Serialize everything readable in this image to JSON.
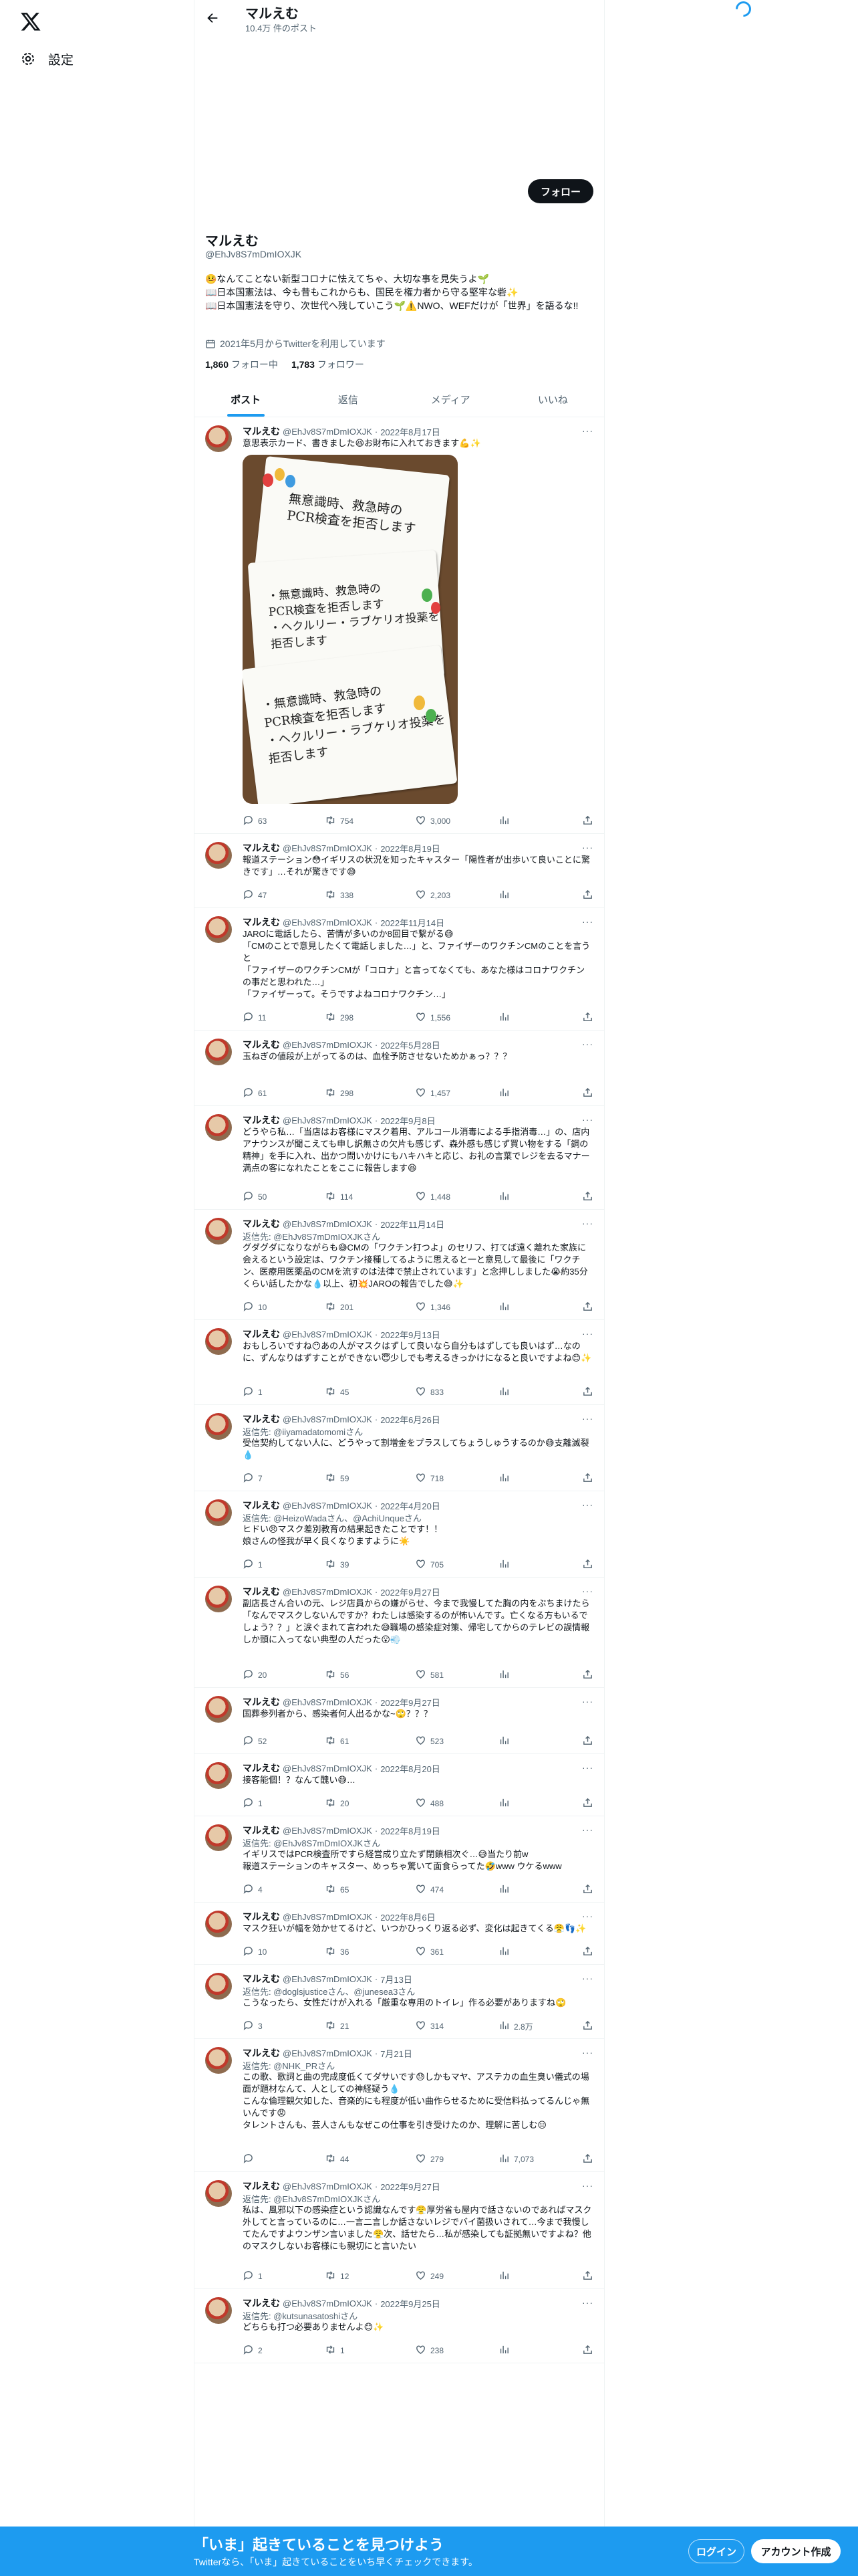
{
  "header": {
    "title": "マルえむ",
    "post_count": "10.4万 件のポスト",
    "follow_label": "フォロー"
  },
  "side": {
    "settings_label": "設定"
  },
  "profile": {
    "name": "マルえむ",
    "handle": "@EhJv8S7mDmIOXJK",
    "bio": [
      "🤒なんてことない新型コロナに怯えてちゃ、大切な事を見失うよ🌱",
      "📖日本国憲法は、今も昔もこれからも、国民を権力者から守る堅牢な砦✨",
      "📖日本国憲法を守り、次世代へ残していこう🌱⚠️NWO、WEFだけが「世界」を語るな!!"
    ],
    "joined": "2021年5月からTwitterを利用しています",
    "following_count": "1,860",
    "following_label": "フォロー中",
    "followers_count": "1,783",
    "followers_label": "フォロワー"
  },
  "tabs": [
    {
      "label": "ポスト"
    },
    {
      "label": "返信"
    },
    {
      "label": "メディア"
    },
    {
      "label": "いいね"
    }
  ],
  "tweets": [
    {
      "name": "マルえむ",
      "handle": "@EhJv8S7mDmIOXJK",
      "date": "2022年8月17日",
      "reply": "",
      "text": "意思表示カード、書きました😆お財布に入れておきます💪✨",
      "media": true,
      "replies": "63",
      "retweets": "754",
      "likes": "3,000",
      "views": ""
    },
    {
      "name": "マルえむ",
      "handle": "@EhJv8S7mDmIOXJK",
      "date": "2022年8月19日",
      "reply": "",
      "text": "報道ステーション😳イギリスの状況を知ったキャスター「陽性者が出歩いて良いことに驚きです」…それが驚きです😅",
      "replies": "47",
      "retweets": "338",
      "likes": "2,203",
      "views": ""
    },
    {
      "name": "マルえむ",
      "handle": "@EhJv8S7mDmIOXJK",
      "date": "2022年11月14日",
      "reply": "",
      "text": "JAROに電話したら、苦情が多いのか8回目で繋がる😅\n「CMのことで意見したくて電話しました…」と、ファイザーのワクチンCMのことを言うと\n「ファイザーのワクチンCMが「コロナ」と言ってなくても、あなた様はコロナワクチンの事だと思われた…」\n「ファイザーって。そうですよねコロナワクチン…」",
      "replies": "11",
      "retweets": "298",
      "likes": "1,556",
      "views": ""
    },
    {
      "name": "マルえむ",
      "handle": "@EhJv8S7mDmIOXJK",
      "date": "2022年5月28日",
      "reply": "",
      "text": "玉ねぎの値段が上がってるのは、血栓予防させないためかぁっ？？？",
      "replies": "61",
      "retweets": "298",
      "likes": "1,457",
      "views": ""
    },
    {
      "name": "マルえむ",
      "handle": "@EhJv8S7mDmIOXJK",
      "date": "2022年9月8日",
      "reply": "",
      "text": "どうやら私…「当店はお客様にマスク着用、アルコール消毒による手指消毒…」の、店内アナウンスが聞こえても申し訳無さの欠片も感じず、森外感も感じず買い物をする「鋼の精神」を手に入れ、出かつ問いかけにもハキハキと応じ、お礼の言葉でレジを去るマナー満点の客になれたことをここに報告します😆",
      "replies": "50",
      "retweets": "114",
      "likes": "1,448",
      "views": ""
    },
    {
      "name": "マルえむ",
      "handle": "@EhJv8S7mDmIOXJK",
      "date": "2022年11月14日",
      "reply": "返信先: @EhJv8S7mDmIOXJKさん",
      "text": "グダグダになりながらも😅CMの「ワクチン打つよ」のセリフ、打てば遠く離れた家族に会えるという設定は、ワクチン接種してるように思えると一と意見して最後に「ワクチン、医療用医薬品のCMを流すのは法律で禁止されています」と念押ししました😭約35分くらい話したかな💧以上、初💥JAROの報告でした😅✨",
      "replies": "10",
      "retweets": "201",
      "likes": "1,346",
      "views": ""
    },
    {
      "name": "マルえむ",
      "handle": "@EhJv8S7mDmIOXJK",
      "date": "2022年9月13日",
      "reply": "",
      "text": "おもしろいですね😶あの人がマスクはずして良いなら自分もはずしても良いはず…なのに、ずんなりはずすことができない😇少しでも考えるきっかけになると良いですよね😊✨",
      "replies": "1",
      "retweets": "45",
      "likes": "833",
      "views": ""
    },
    {
      "name": "マルえむ",
      "handle": "@EhJv8S7mDmIOXJK",
      "date": "2022年6月26日",
      "reply": "返信先: @iiyamadatomomiさん",
      "text": "受信契約してない人に、どうやって割増金をプラスしてちょうしゅうするのか😅支離滅裂💧",
      "replies": "7",
      "retweets": "59",
      "likes": "718",
      "views": ""
    },
    {
      "name": "マルえむ",
      "handle": "@EhJv8S7mDmIOXJK",
      "date": "2022年4月20日",
      "reply": "返信先: @HeizoWadaさん、@AchiUnqueさん",
      "text": "ヒドい😠マスク差別教育の結果起きたことです！！\n娘さんの怪我が早く良くなりますように☀️",
      "replies": "1",
      "retweets": "39",
      "likes": "705",
      "views": ""
    },
    {
      "name": "マルえむ",
      "handle": "@EhJv8S7mDmIOXJK",
      "date": "2022年9月27日",
      "reply": "",
      "text": "副店長さん合いの元、レジ店員からの嫌がらせ、今まで我慢してた胸の内をぶちまけたら「なんでマスクしないんですか？わたしは感染するのが怖いんです。亡くなる方もいるでしょう？？」と涙ぐまれて言われた😅職場の感染症対策、帰宅してからのテレビの誤情報しか頭に入ってない典型の人だった😮💨",
      "replies": "20",
      "retweets": "56",
      "likes": "581",
      "views": ""
    },
    {
      "name": "マルえむ",
      "handle": "@EhJv8S7mDmIOXJK",
      "date": "2022年9月27日",
      "reply": "",
      "text": "国葬参列者から、感染者何人出るかな~🙄？？？",
      "replies": "52",
      "retweets": "61",
      "likes": "523",
      "views": ""
    },
    {
      "name": "マルえむ",
      "handle": "@EhJv8S7mDmIOXJK",
      "date": "2022年8月20日",
      "reply": "",
      "text": "接客能個！？なんて醜い😅…",
      "replies": "1",
      "retweets": "20",
      "likes": "488",
      "views": ""
    },
    {
      "name": "マルえむ",
      "handle": "@EhJv8S7mDmIOXJK",
      "date": "2022年8月19日",
      "reply": "返信先: @EhJv8S7mDmIOXJKさん",
      "text": "イギリスではPCR検査所ですら経営成り立たず閉鎖相次ぐ…😅当たり前w\n報道ステーションのキャスター、めっちゃ驚いて面食らってた🤣www ウケるwww",
      "replies": "4",
      "retweets": "65",
      "likes": "474",
      "views": ""
    },
    {
      "name": "マルえむ",
      "handle": "@EhJv8S7mDmIOXJK",
      "date": "2022年8月6日",
      "reply": "",
      "text": "マスク狂いが幅を効かせてるけど、いつかひっくり返る必ず、変化は起きてくる😤👣✨",
      "replies": "10",
      "retweets": "36",
      "likes": "361",
      "views": ""
    },
    {
      "name": "マルえむ",
      "handle": "@EhJv8S7mDmIOXJK",
      "date": "7月13日",
      "reply": "返信先: @doglsjusticeさん、@junesea3さん",
      "text": "こうなったら、女性だけが入れる「厳重な専用のトイレ」作る必要がありますね🙄",
      "replies": "3",
      "retweets": "21",
      "likes": "314",
      "views": "2.8万"
    },
    {
      "name": "マルえむ",
      "handle": "@EhJv8S7mDmIOXJK",
      "date": "7月21日",
      "reply": "返信先: @NHK_PRさん",
      "text": "この歌、歌詞と曲の完成度低くてダサいです😓しかもマヤ、アステカの血生臭い儀式の場面が題材なんて、人としての神経疑う💧\nこんな倫理観欠如した、音楽的にも程度が低い曲作らせるために受信料払ってるんじゃ無いんです😡\nタレントさんも、芸人さんもなぜこの仕事を引き受けたのか、理解に苦しむ😑",
      "replies": "",
      "retweets": "44",
      "likes": "279",
      "views": "7,073"
    },
    {
      "name": "マルえむ",
      "handle": "@EhJv8S7mDmIOXJK",
      "date": "2022年9月27日",
      "reply": "返信先: @EhJv8S7mDmIOXJKさん",
      "text": "私は、風邪以下の感染症という認識なんです😤厚労省も屋内で話さないのであればマスク外してと言っているのに…一言二言しか話さないレジでバイ菌扱いされて…今まで我慢してたんですよウンザン言いました😤次、話せたら…私が感染しても証拠無いですよね？他のマスクしないお客様にも親切にと言いたい",
      "replies": "1",
      "retweets": "12",
      "likes": "249",
      "views": ""
    },
    {
      "name": "マルえむ",
      "handle": "@EhJv8S7mDmIOXJK",
      "date": "2022年9月25日",
      "reply": "返信先: @kutsunasatoshiさん",
      "text": "どちらも打つ必要ありませんよ😊✨",
      "replies": "2",
      "retweets": "1",
      "likes": "238",
      "views": ""
    }
  ],
  "card_text": [
    "無意識時、救急時の\nPCR検査を拒否します",
    "・無意識時、救急時の\nPCR検査を拒否します\n・ヘクルリー・ラブケリオ投薬を\n拒否します"
  ],
  "banner": {
    "title": "「いま」起きていることを見つけよう",
    "subtitle": "Twitterなら、「いま」起きていることをいち早くチェックできます。",
    "login_label": "ログイン",
    "signup_label": "アカウント作成"
  },
  "colors": {
    "accent": "#1d9bf0",
    "text": "#0f1419",
    "secondary": "#536471"
  }
}
